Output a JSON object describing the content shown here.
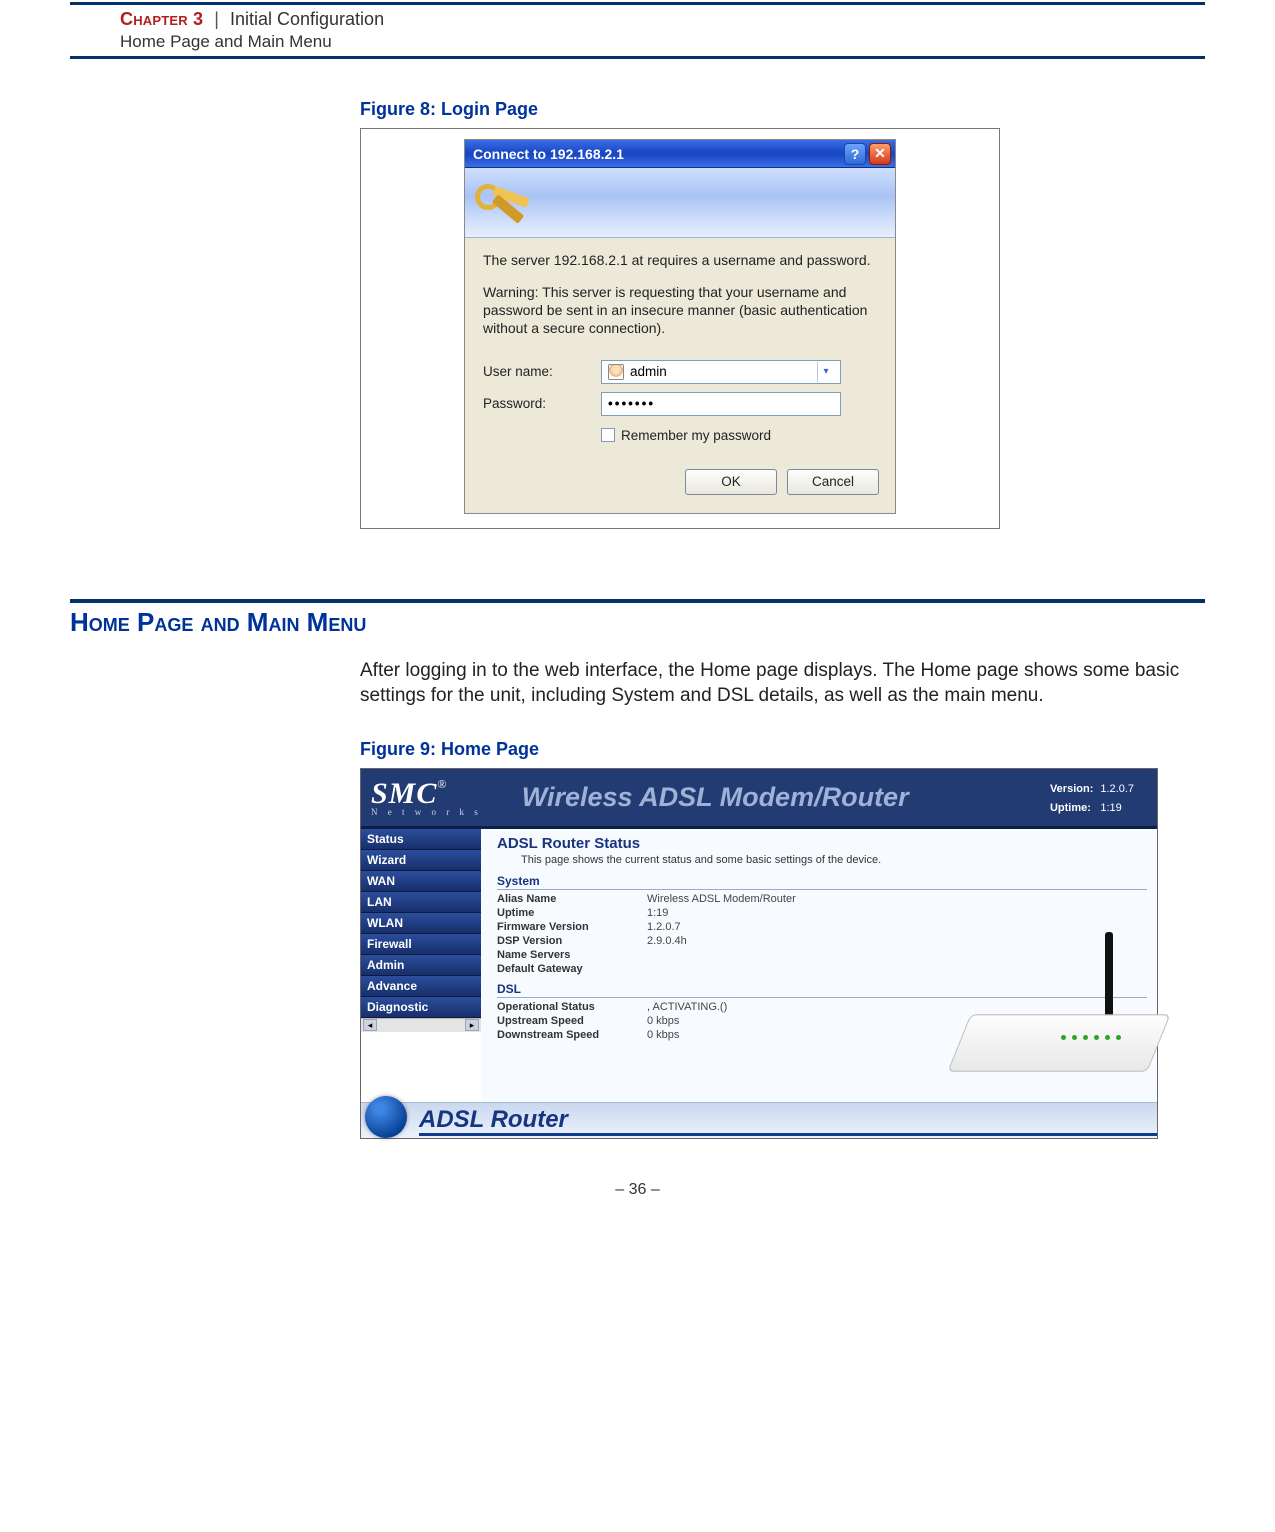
{
  "header": {
    "chapter_label": "Chapter 3",
    "chapter_title": "Initial Configuration",
    "subtitle": "Home Page and Main Menu"
  },
  "figure8": {
    "caption": "Figure 8:  Login Page",
    "dialog": {
      "title": "Connect to 192.168.2.1",
      "text1": "The server 192.168.2.1 at  requires a username and password.",
      "text2": "Warning: This server is requesting that your username and password be sent in an insecure manner (basic authentication without a secure connection).",
      "username_label": "User name:",
      "username_value": "admin",
      "password_label": "Password:",
      "password_value": "•••••••",
      "remember_label": "Remember my password",
      "ok": "OK",
      "cancel": "Cancel"
    }
  },
  "section": {
    "heading": "Home Page and Main Menu",
    "intro": "After logging in to the web interface, the Home page displays. The Home page shows some basic settings for the unit, including System and DSL details, as well as the main menu."
  },
  "figure9": {
    "caption": "Figure 9:  Home Page",
    "header": {
      "brand": "SMC",
      "brand_sub": "N e t w o r k s",
      "title": "Wireless ADSL Modem/Router",
      "version_label": "Version:",
      "version": "1.2.0.7",
      "uptime_label": "Uptime:",
      "uptime": "1:19"
    },
    "sidebar": [
      "Status",
      "Wizard",
      "WAN",
      "LAN",
      "WLAN",
      "Firewall",
      "Admin",
      "Advance",
      "Diagnostic"
    ],
    "status": {
      "title": "ADSL Router Status",
      "subtitle": "This page shows the current status and some basic settings of the device.",
      "system_label": "System",
      "system": [
        {
          "k": "Alias Name",
          "v": "Wireless ADSL Modem/Router"
        },
        {
          "k": "Uptime",
          "v": "1:19"
        },
        {
          "k": "Firmware Version",
          "v": "1.2.0.7"
        },
        {
          "k": "DSP Version",
          "v": "2.9.0.4h"
        },
        {
          "k": "Name Servers",
          "v": ""
        },
        {
          "k": "Default Gateway",
          "v": ""
        }
      ],
      "dsl_label": "DSL",
      "dsl": [
        {
          "k": "Operational Status",
          "v": ", ACTIVATING.()"
        },
        {
          "k": "Upstream Speed",
          "v": "0 kbps"
        },
        {
          "k": "Downstream Speed",
          "v": "0 kbps"
        }
      ]
    },
    "footer": "ADSL Router"
  },
  "page_number": "–  36  –"
}
